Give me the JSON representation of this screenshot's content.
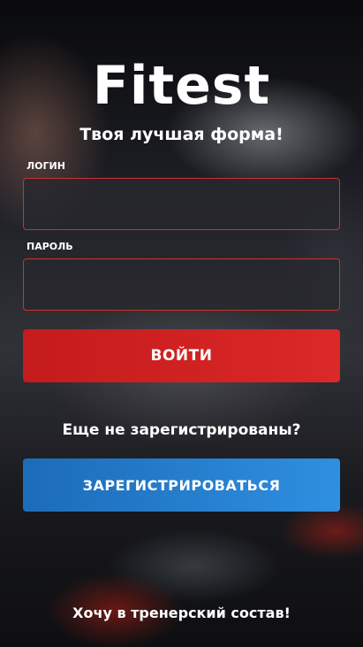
{
  "app": {
    "logo": "Fitest",
    "tagline": "Твоя лучшая форма!"
  },
  "login_form": {
    "login_label": "ЛОГИН",
    "login_value": "",
    "password_label": "ПАРОЛЬ",
    "password_value": "",
    "submit_label": "ВОЙТИ"
  },
  "register": {
    "question": "Еще не зарегистрированы?",
    "button_label": "ЗАРЕГИСТРИРОВАТЬСЯ"
  },
  "trainer_link": "Хочу в тренерский состав!",
  "colors": {
    "login_button": "#d02222",
    "register_button": "#2a82d4",
    "field_border": "#d0302f",
    "text": "#ffffff"
  }
}
